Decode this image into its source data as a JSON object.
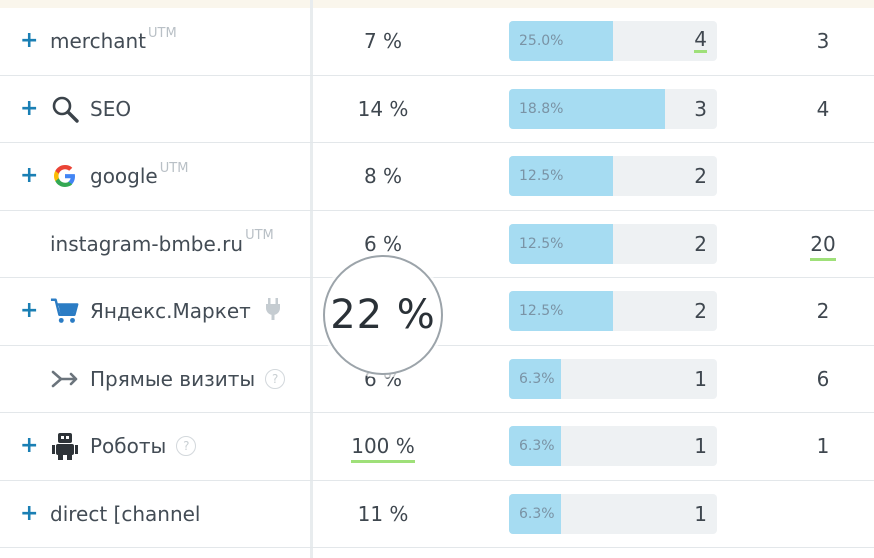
{
  "colors": {
    "bar_fill": "#a6dcf2",
    "bar_track": "#eef1f3",
    "plus": "#1a7fb4",
    "underline_accent": "#9fe079"
  },
  "rows": [
    {
      "expand": "+",
      "icon": "",
      "name": "merchant",
      "sup": "UTM",
      "pct": "7 %",
      "bar_pct": "25.0%",
      "bar_fraction": 0.5,
      "bar_value": "4",
      "last": "3"
    },
    {
      "expand": "+",
      "icon": "magnifier-icon",
      "name": "SEO",
      "sup": "",
      "pct": "14 %",
      "bar_pct": "18.8%",
      "bar_fraction": 0.75,
      "bar_value": "3",
      "last": "4"
    },
    {
      "expand": "+",
      "icon": "google-icon",
      "name": "google",
      "sup": "UTM",
      "pct": "8 %",
      "bar_pct": "12.5%",
      "bar_fraction": 0.5,
      "bar_value": "2",
      "last": ""
    },
    {
      "expand": "",
      "icon": "",
      "name": "instagram-bmbe.ru",
      "sup": "UTM",
      "pct": "6 %",
      "bar_pct": "12.5%",
      "bar_fraction": 0.5,
      "bar_value": "2",
      "last": "20"
    },
    {
      "expand": "+",
      "icon": "shopping-cart-icon",
      "name": "Яндекс.Маркет",
      "sup": "",
      "pct": "",
      "bar_pct": "12.5%",
      "bar_fraction": 0.5,
      "bar_value": "2",
      "last": "2"
    },
    {
      "expand": "",
      "icon": "direct-visits-icon",
      "name": "Прямые визиты",
      "sup": "",
      "help": "?",
      "pct": "6 %",
      "bar_pct": "6.3%",
      "bar_fraction": 0.25,
      "bar_value": "1",
      "last": "6"
    },
    {
      "expand": "+",
      "icon": "robot-icon",
      "name": "Роботы",
      "sup": "",
      "help": "?",
      "pct": "100 %",
      "bar_pct": "6.3%",
      "bar_fraction": 0.25,
      "bar_value": "1",
      "last": "1"
    },
    {
      "expand": "+",
      "icon": "",
      "name": "direct [channel",
      "sup": "",
      "pct": "11 %",
      "bar_pct": "6.3%",
      "bar_fraction": 0.25,
      "bar_value": "1",
      "last": ""
    }
  ],
  "magnifier": {
    "value": "22 %"
  }
}
